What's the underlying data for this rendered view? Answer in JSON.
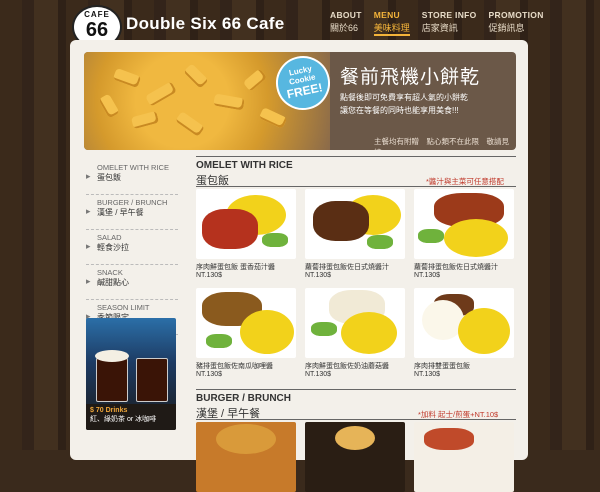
{
  "site": {
    "logo_top": "CAFE",
    "logo_num": "66",
    "brand": "Double Six 66 Cafe"
  },
  "nav": [
    {
      "en": "ABOUT",
      "zh": "關於66",
      "active": false
    },
    {
      "en": "MENU",
      "zh": "美味料理",
      "active": true
    },
    {
      "en": "STORE INFO",
      "zh": "店家資訊",
      "active": false
    },
    {
      "en": "PROMOTION",
      "zh": "促銷訊息",
      "active": false
    }
  ],
  "hero": {
    "badge_a": "Lucky Cookie",
    "badge_b": "FREE!",
    "title": "餐前飛機小餅乾",
    "line1": "點餐後即可免費享有超人氣的小餅乾",
    "line2": "讓您在等餐的同時也能享用美食!!!",
    "foot": "主餐均有附贈　點心類不在此限　敬請見諒"
  },
  "sidebar": [
    {
      "en": "OMELET WITH RICE",
      "zh": "蛋包飯"
    },
    {
      "en": "BURGER / BRUNCH",
      "zh": "漢堡 / 早午餐"
    },
    {
      "en": "SALAD",
      "zh": "輕食沙拉"
    },
    {
      "en": "SNACK",
      "zh": "鹹甜點心"
    },
    {
      "en": "SEASON LIMIT",
      "zh": "季節限定"
    }
  ],
  "promo": {
    "price": "$ 70 Drinks",
    "text": "紅、綠奶茶 or 冰咖啡"
  },
  "sections": {
    "omelet": {
      "en": "OMELET WITH RICE",
      "zh": "蛋包飯",
      "note": "*醬汁與主菜可任意搭配"
    },
    "burger": {
      "en": "BURGER / BRUNCH",
      "zh": "漢堡 / 早午餐",
      "note": "*加料 起士/煎蛋+NT.10$"
    }
  },
  "cards": [
    {
      "cap": "序肉鮮蛋包飯 蛋香茄汁醬",
      "price": "NT.130$"
    },
    {
      "cap": "蘿蔔排蛋包飯佐日式燒醬汁",
      "price": "NT.130$"
    },
    {
      "cap": "蘿蔔排蛋包飯佐日式燒醬汁",
      "price": "NT.130$"
    },
    {
      "cap": "豬排蛋包飯佐南瓜咖哩醬",
      "price": "NT.130$"
    },
    {
      "cap": "序肉鮮蛋包飯佐奶油蘑菇醬",
      "price": "NT.130$"
    },
    {
      "cap": "序肉排雙蛋蛋包飯",
      "price": "NT.130$"
    }
  ]
}
